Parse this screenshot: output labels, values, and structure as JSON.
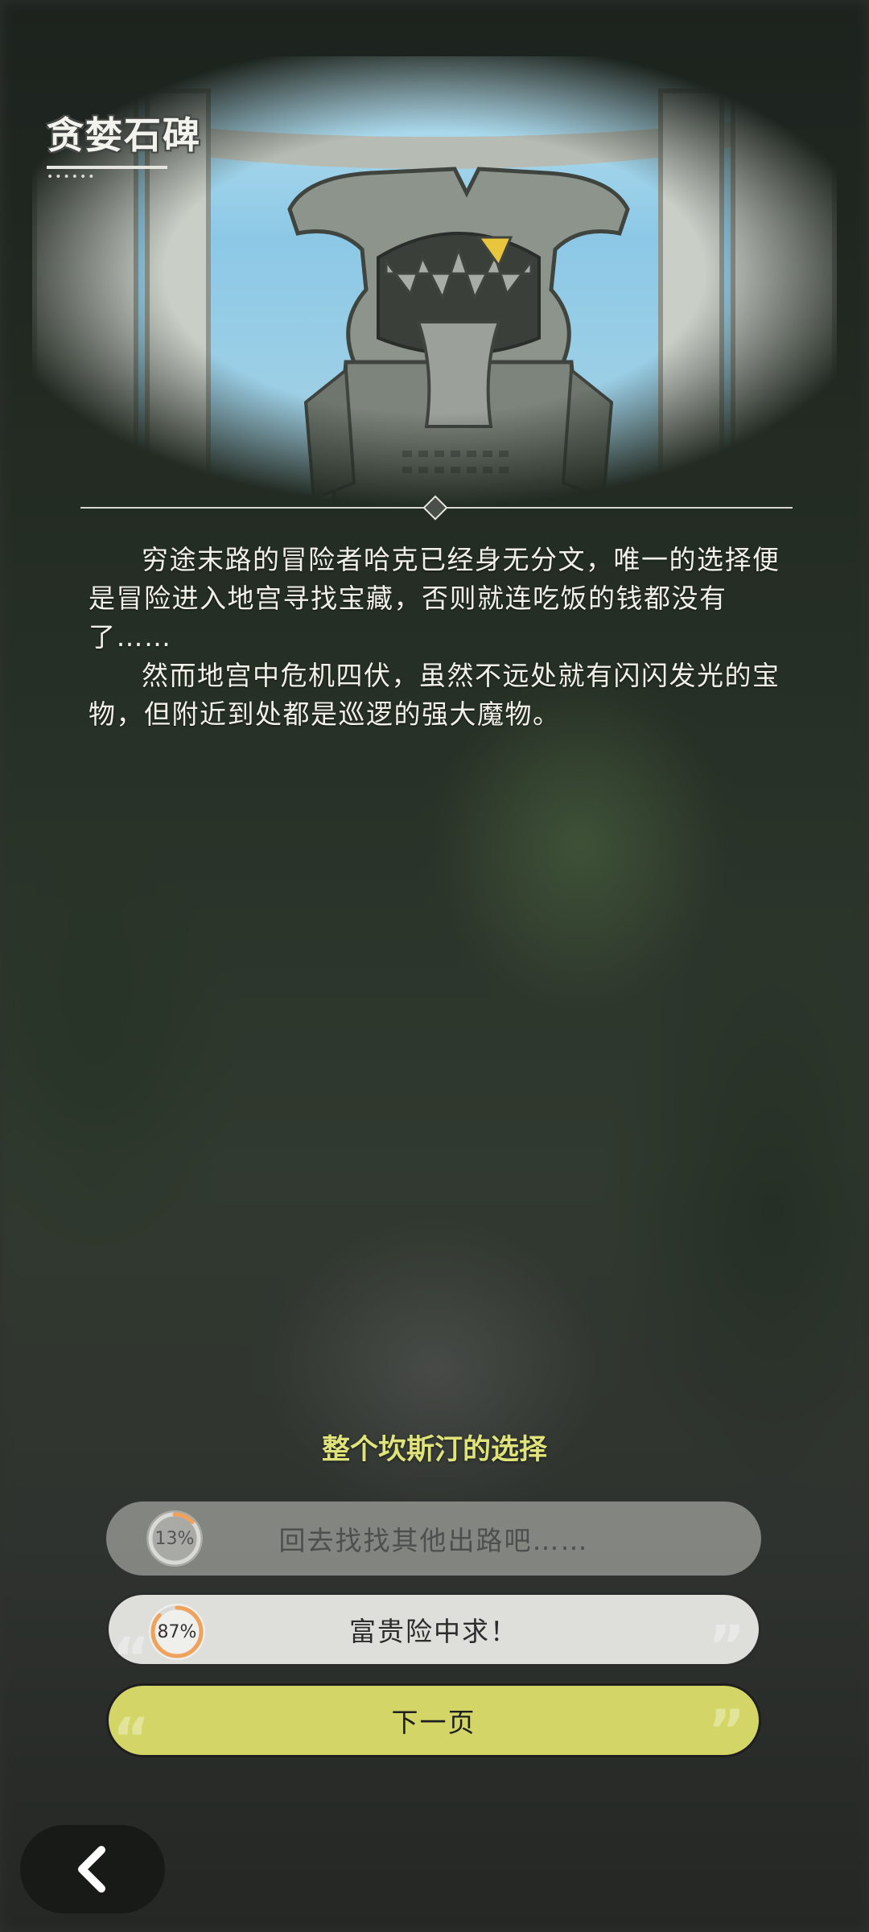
{
  "header": {
    "title": "贪婪石碑",
    "title_dots": "••••••"
  },
  "story": {
    "paragraphs": [
      "穷途末路的冒险者哈克已经身无分文，唯一的选择便是冒险进入地宫寻找宝藏，否则就连吃饭的钱都没有了……",
      "然而地宫中危机四伏，虽然不远处就有闪闪发光的宝物，但附近到处都是巡逻的强大魔物。"
    ]
  },
  "question": {
    "text": "整个坎斯汀的选择"
  },
  "choices": [
    {
      "label": "回去找找其他出路吧……",
      "percent": "13%",
      "fraction": 0.13
    },
    {
      "label": "富贵险中求！",
      "percent": "87%",
      "fraction": 0.87
    }
  ],
  "next_button": {
    "label": "下一页"
  },
  "icons": {
    "back": "chevron-left-icon"
  },
  "colors": {
    "accent_yellow": "#d3d667",
    "question_text": "#dfe37a",
    "progress_orange": "#f0a15c"
  }
}
